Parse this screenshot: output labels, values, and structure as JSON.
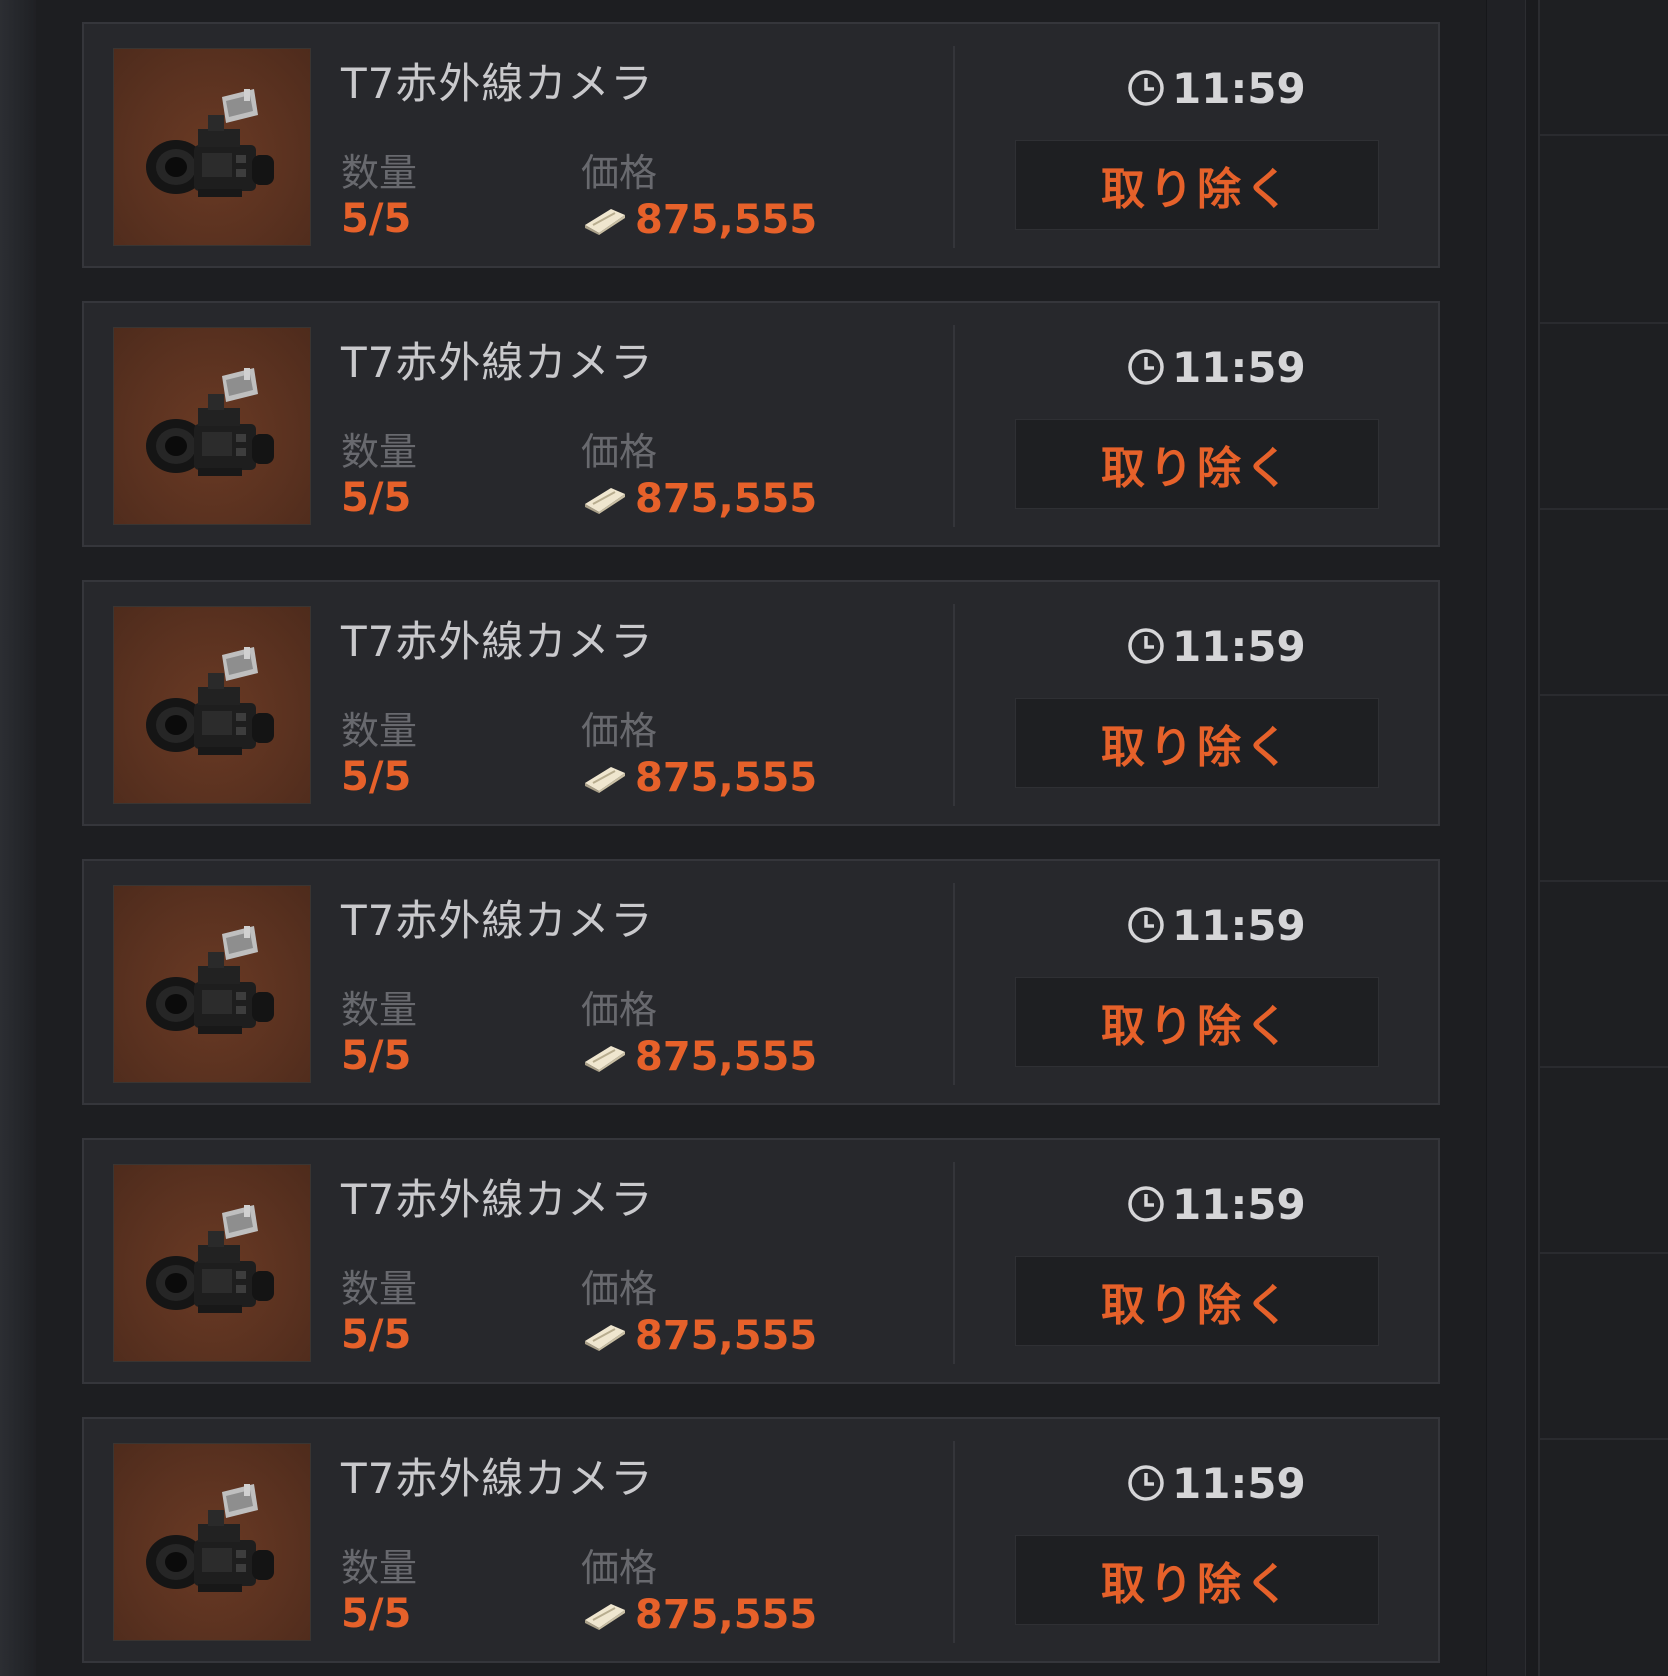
{
  "listings": [
    {
      "name": "T7赤外線カメラ",
      "quantity_label": "数量",
      "quantity": "5/5",
      "price_label": "価格",
      "price": "875,555",
      "time_left": "11:59",
      "remove_label": "取り除く",
      "item_icon": "infrared-camera-icon",
      "currency_icon": "cash-icon",
      "timer_icon": "clock-icon"
    },
    {
      "name": "T7赤外線カメラ",
      "quantity_label": "数量",
      "quantity": "5/5",
      "price_label": "価格",
      "price": "875,555",
      "time_left": "11:59",
      "remove_label": "取り除く",
      "item_icon": "infrared-camera-icon",
      "currency_icon": "cash-icon",
      "timer_icon": "clock-icon"
    },
    {
      "name": "T7赤外線カメラ",
      "quantity_label": "数量",
      "quantity": "5/5",
      "price_label": "価格",
      "price": "875,555",
      "time_left": "11:59",
      "remove_label": "取り除く",
      "item_icon": "infrared-camera-icon",
      "currency_icon": "cash-icon",
      "timer_icon": "clock-icon"
    },
    {
      "name": "T7赤外線カメラ",
      "quantity_label": "数量",
      "quantity": "5/5",
      "price_label": "価格",
      "price": "875,555",
      "time_left": "11:59",
      "remove_label": "取り除く",
      "item_icon": "infrared-camera-icon",
      "currency_icon": "cash-icon",
      "timer_icon": "clock-icon"
    },
    {
      "name": "T7赤外線カメラ",
      "quantity_label": "数量",
      "quantity": "5/5",
      "price_label": "価格",
      "price": "875,555",
      "time_left": "11:59",
      "remove_label": "取り除く",
      "item_icon": "infrared-camera-icon",
      "currency_icon": "cash-icon",
      "timer_icon": "clock-icon"
    },
    {
      "name": "T7赤外線カメラ",
      "quantity_label": "数量",
      "quantity": "5/5",
      "price_label": "価格",
      "price": "875,555",
      "time_left": "11:59",
      "remove_label": "取り除く",
      "item_icon": "infrared-camera-icon",
      "currency_icon": "cash-icon",
      "timer_icon": "clock-icon"
    }
  ],
  "colors": {
    "accent": "#e6612a",
    "background": "#1d1e21",
    "card": "#27282c",
    "card_border": "#35363b",
    "thumbnail": "#5b3220",
    "text_primary": "#c9c9cc",
    "text_muted": "#68696e"
  }
}
